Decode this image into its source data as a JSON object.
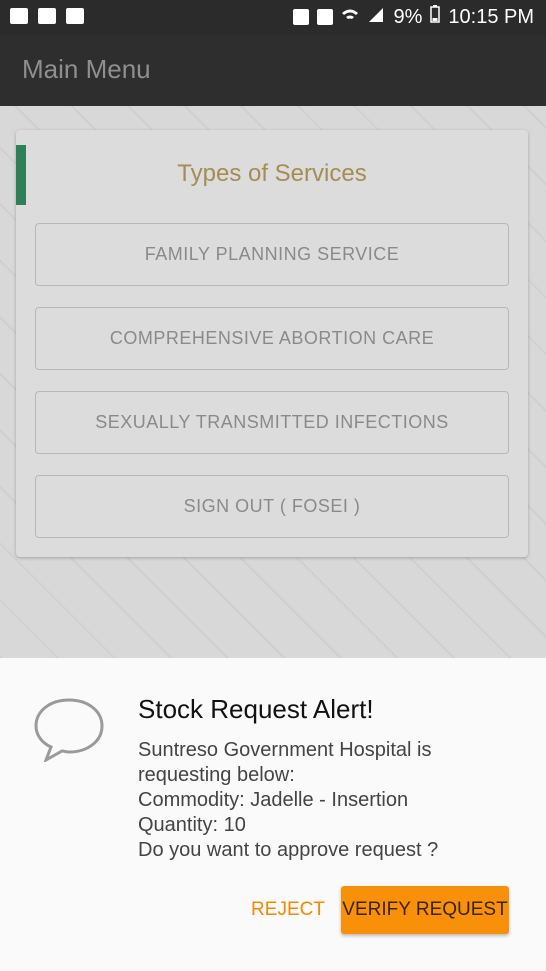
{
  "status_bar": {
    "time": "10:15 PM",
    "battery": "9%",
    "icons": [
      "image-icon",
      "gallery-icon",
      "fingerprint-icon",
      "lock-icon",
      "sync-icon",
      "wifi-icon",
      "signal-icon",
      "battery-icon"
    ]
  },
  "app_bar": {
    "title": "Main Menu"
  },
  "card": {
    "title": "Types of Services",
    "buttons": [
      "FAMILY PLANNING SERVICE",
      "COMPREHENSIVE ABORTION CARE",
      "SEXUALLY TRANSMITTED INFECTIONS",
      "SIGN OUT ( FOSEI )"
    ]
  },
  "dialog": {
    "title": "Stock Request Alert!",
    "message": " Suntreso Government Hospital is requesting below:\n Commodity: Jadelle - Insertion\n Quantity: 10\n Do you want to approve request ?",
    "reject_label": "REJECT",
    "verify_label": "VERIFY REQUEST"
  },
  "colors": {
    "accent": "#f8900a",
    "title_gold": "#a48d52",
    "card_accent": "#2f7f5b"
  }
}
